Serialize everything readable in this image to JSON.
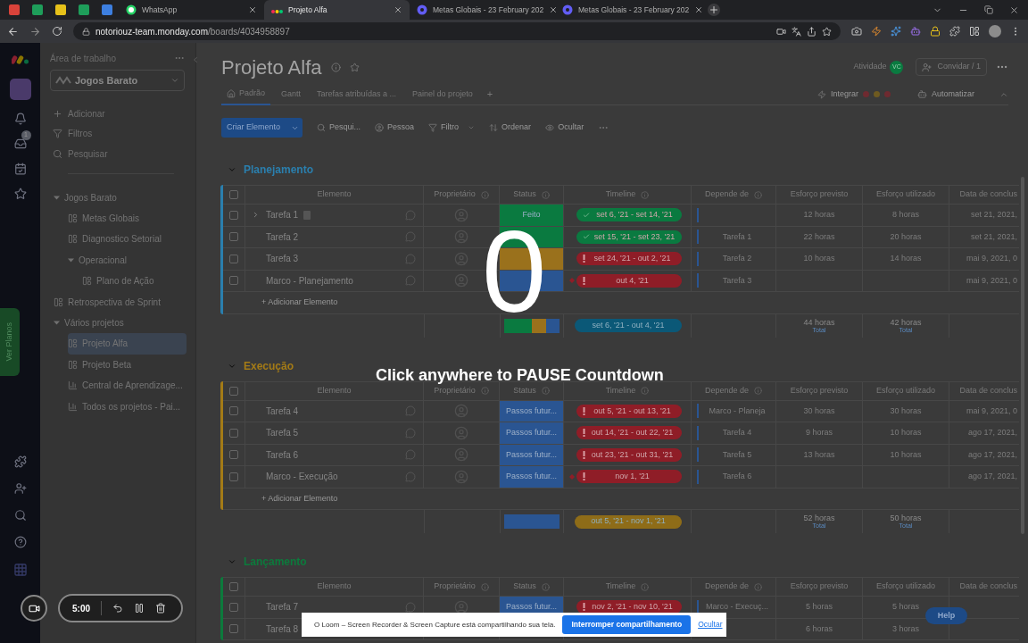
{
  "browser": {
    "tabs": [
      {
        "kind": "favicon",
        "color": "#d9433a"
      },
      {
        "kind": "favicon",
        "color": "#1e9e5a"
      },
      {
        "kind": "favicon",
        "color": "#e7c21a"
      },
      {
        "kind": "favicon",
        "color": "#1e9e5a"
      },
      {
        "kind": "favicon",
        "color": "#3d7fe0"
      },
      {
        "kind": "chat",
        "title": "WhatsApp",
        "selected": false
      },
      {
        "kind": "board",
        "title": "Projeto Alfa",
        "selected": true
      },
      {
        "kind": "recording",
        "title": "Metas Globais - 23 February 202",
        "selected": false
      },
      {
        "kind": "recording",
        "title": "Metas Globais - 23 February 202",
        "selected": false
      }
    ],
    "url_domain": "notoriouz-team.monday.com",
    "url_path": "/boards/4034958897"
  },
  "rail": {
    "badge_count": "1",
    "plans": "Ver Planos"
  },
  "sidebar": {
    "heading": "Área de trabalho",
    "workspace": "Jogos Barato",
    "actions": [
      {
        "kind": "add",
        "label": "Adicionar"
      },
      {
        "kind": "filter",
        "label": "Filtros"
      },
      {
        "kind": "search",
        "label": "Pesquisar"
      }
    ],
    "tree": [
      {
        "kind": "folder",
        "label": "Jogos Barato",
        "expanded": true,
        "selected": false,
        "children": [
          {
            "kind": "board",
            "label": "Metas Globais",
            "selected": false
          },
          {
            "kind": "board",
            "label": "Diagnostico Setorial",
            "selected": false
          },
          {
            "kind": "folder",
            "label": "Operacional",
            "expanded": true,
            "selected": false,
            "children": [
              {
                "kind": "board",
                "label": "Plano de Ação",
                "selected": false
              }
            ]
          }
        ]
      },
      {
        "kind": "board",
        "label": "Retrospectiva de Sprint",
        "selected": false
      },
      {
        "kind": "folder",
        "label": "Vários projetos",
        "expanded": true,
        "selected": false,
        "children": [
          {
            "kind": "board",
            "label": "Projeto Alfa",
            "selected": true
          },
          {
            "kind": "board",
            "label": "Projeto Beta",
            "selected": false
          },
          {
            "kind": "dashboard",
            "label": "Central de Aprendizage...",
            "selected": false
          },
          {
            "kind": "dashboard",
            "label": "Todos os projetos - Pai...",
            "selected": false
          }
        ]
      }
    ]
  },
  "board": {
    "title": "Projeto Alfa",
    "activity": "Atividade",
    "avatar": "VC",
    "invite": "Convidar / 1",
    "views": [
      {
        "label": "Padrão",
        "selected": true
      },
      {
        "label": "Gantt",
        "selected": false
      },
      {
        "label": "Tarefas atribuídas a ...",
        "selected": false
      },
      {
        "label": "Painel do projeto",
        "selected": false
      }
    ],
    "add_view": "+",
    "integrate": "Integrar",
    "automate": "Automatizar",
    "create": "Criar Elemento",
    "tools": [
      {
        "kind": "search",
        "label": "Pesqui..."
      },
      {
        "kind": "person",
        "label": "Pessoa"
      },
      {
        "kind": "filter",
        "label": "Filtro"
      },
      {
        "kind": "sort",
        "label": "Ordenar"
      },
      {
        "kind": "hide",
        "label": "Ocultar"
      }
    ]
  },
  "groups": [
    {
      "title": "Planejamento",
      "color": "#2a7fae",
      "all_checked": false,
      "columns": [
        "Elemento",
        "Proprietário",
        "Status",
        "Timeline",
        "Depende de",
        "Esforço previsto",
        "Esforço utilizado",
        "Data de conclus"
      ],
      "rows": [
        {
          "name": "Tarefa 1",
          "checked": false,
          "expandable": true,
          "status": {
            "label": "Feito",
            "color": "#0a7a40"
          },
          "timeline": {
            "kind": "done",
            "label": "set 6, '21 - set 14, '21",
            "color": "#0a7a40",
            "milestone": false
          },
          "planned": "12 horas",
          "used": "8 horas",
          "date": "set 21, 2021,"
        },
        {
          "name": "Tarefa 2",
          "checked": false,
          "expandable": false,
          "status": {
            "color": "#0a7a40"
          },
          "timeline": {
            "kind": "done",
            "label": "set 15, '21 - set 23, '21",
            "color": "#0a7a40",
            "milestone": false
          },
          "depends": "Tarefa 1",
          "planned": "22 horas",
          "used": "20 horas",
          "date": "set 21, 2021,"
        },
        {
          "name": "Tarefa 3",
          "checked": false,
          "expandable": false,
          "status": {
            "color": "#9a711c"
          },
          "timeline": {
            "kind": "late",
            "label": "set 24, '21 - out 2, '21",
            "color": "#8f1d27",
            "milestone": false
          },
          "depends": "Tarefa 2",
          "planned": "10 horas",
          "used": "14 horas",
          "date": "mai 9, 2021, 0"
        },
        {
          "name": "Marco - Planejamento",
          "checked": false,
          "expandable": false,
          "status": {
            "color": "#2a5592"
          },
          "timeline": {
            "kind": "late",
            "label": "out 4, '21",
            "color": "#8f1d27",
            "milestone": true
          },
          "depends": "Tarefa 3",
          "date": "mai 9, 2021, 0"
        }
      ],
      "add": "+ Adicionar Elemento",
      "summary": {
        "segments": [
          {
            "color": "#0a7a40"
          },
          {
            "color": "#0a7a40"
          },
          {
            "color": "#9a711c"
          },
          {
            "color": "#2a5592"
          }
        ],
        "timeline": {
          "label": "set 6, '21 - out 4, '21",
          "color": "#0b5877"
        },
        "planned": "44 horas",
        "planned_note": "Total",
        "used": "42 horas",
        "used_note": "Total"
      }
    },
    {
      "title": "Execução",
      "color": "#a47b16",
      "all_checked": false,
      "columns": [
        "Elemento",
        "Proprietário",
        "Status",
        "Timeline",
        "Depende de",
        "Esforço previsto",
        "Esforço utilizado",
        "Data de conclus"
      ],
      "rows": [
        {
          "name": "Tarefa 4",
          "checked": false,
          "expandable": false,
          "status": {
            "label": "Passos futur...",
            "color": "#2a5592"
          },
          "timeline": {
            "kind": "late",
            "label": "out 5, '21 - out 13, '21",
            "color": "#8f1d27",
            "milestone": false
          },
          "depends": "Marco - Planeja",
          "planned": "30 horas",
          "used": "30 horas",
          "date": "mai 9, 2021, 0"
        },
        {
          "name": "Tarefa 5",
          "checked": false,
          "expandable": false,
          "status": {
            "label": "Passos futur...",
            "color": "#2a5592"
          },
          "timeline": {
            "kind": "late",
            "label": "out 14, '21 - out 22, '21",
            "color": "#8f1d27",
            "milestone": false
          },
          "depends": "Tarefa 4",
          "planned": "9 horas",
          "used": "10 horas",
          "date": "ago 17, 2021,"
        },
        {
          "name": "Tarefa 6",
          "checked": false,
          "expandable": false,
          "status": {
            "label": "Passos futur...",
            "color": "#2a5592"
          },
          "timeline": {
            "kind": "late",
            "label": "out 23, '21 - out 31, '21",
            "color": "#8f1d27",
            "milestone": false
          },
          "depends": "Tarefa 5",
          "planned": "13 horas",
          "used": "10 horas",
          "date": "ago 17, 2021,"
        },
        {
          "name": "Marco - Execução",
          "checked": false,
          "expandable": false,
          "status": {
            "label": "Passos futur...",
            "color": "#2a5592"
          },
          "timeline": {
            "kind": "late",
            "label": "nov 1, '21",
            "color": "#8f1d27",
            "milestone": true
          },
          "depends": "Tarefa 6",
          "date": "ago 17, 2021,"
        }
      ],
      "add": "+ Adicionar Elemento",
      "summary": {
        "segments": [
          {
            "color": "#2a5592"
          },
          {
            "color": "#2a5592"
          },
          {
            "color": "#2a5592"
          },
          {
            "color": "#2a5592"
          }
        ],
        "timeline": {
          "label": "out 5, '21 - nov 1, '21",
          "color": "#8e6c18"
        },
        "planned": "52 horas",
        "planned_note": "Total",
        "used": "50 horas",
        "used_note": "Total"
      }
    },
    {
      "title": "Lançamento",
      "color": "#0c7a3c",
      "all_checked": false,
      "columns": [
        "Elemento",
        "Proprietário",
        "Status",
        "Timeline",
        "Depende de",
        "Esforço previsto",
        "Esforço utilizado",
        "Data de conclus"
      ],
      "rows": [
        {
          "name": "Tarefa 7",
          "checked": false,
          "expandable": false,
          "status": {
            "label": "Passos futur...",
            "color": "#2a5592"
          },
          "timeline": {
            "kind": "late",
            "label": "nov 2, '21 - nov 10, '21",
            "color": "#8f1d27",
            "milestone": false
          },
          "depends": "Marco - Execuç...",
          "planned": "5 horas",
          "used": "5 horas"
        },
        {
          "name": "Tarefa 8",
          "checked": false,
          "expandable": false,
          "planned": "6 horas",
          "used": "3 horas"
        }
      ]
    }
  ],
  "countdown": {
    "number": "0",
    "hint": "Click anywhere to PAUSE Countdown"
  },
  "recorder": {
    "time": "5:00"
  },
  "share_bar": {
    "message": "O Loom – Screen Recorder & Screen Capture está compartilhando sua tela.",
    "stop": "Interromper compartilhamento",
    "hide": "Ocultar"
  },
  "help": "Help"
}
